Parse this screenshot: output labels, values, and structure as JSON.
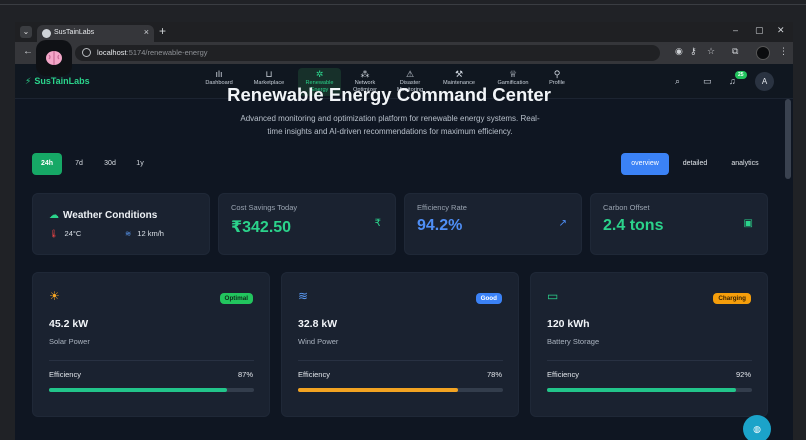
{
  "browser": {
    "tab_title": "SusTainLabs",
    "url_host": "localhost",
    "url_path": ":5174/renewable-energy",
    "new_tab": "+",
    "close": "×",
    "minimize": "–",
    "restore": "▢",
    "win_close": "✕"
  },
  "app": {
    "logo": "SusTainLabs",
    "nav": [
      {
        "label": "Dashboard",
        "icon": "bar-chart-icon"
      },
      {
        "label": "Marketplace",
        "icon": "cart-icon"
      },
      {
        "label": "Renewable Energy",
        "icon": "sparkle-icon",
        "active": true
      },
      {
        "label": "Network Optimizer",
        "icon": "network-icon"
      },
      {
        "label": "Disaster Monitoring",
        "icon": "warning-icon"
      },
      {
        "label": "Maintenance",
        "icon": "wrench-icon"
      },
      {
        "label": "Gamification",
        "icon": "trophy-icon"
      },
      {
        "label": "Profile",
        "icon": "user-icon"
      }
    ],
    "notification_count": "25",
    "avatar_initial": "A"
  },
  "hero": {
    "title": "Renewable Energy Command Center",
    "subtitle": "Advanced monitoring and optimization platform for renewable energy systems. Real-time insights and AI-driven recommendations for maximum efficiency."
  },
  "time_ranges": [
    "24h",
    "7d",
    "30d",
    "1y"
  ],
  "active_range": "24h",
  "views": [
    "overview",
    "detailed",
    "analytics"
  ],
  "active_view": "overview",
  "weather": {
    "title": "Weather Conditions",
    "temperature": "24°C",
    "wind": "12 km/h"
  },
  "kpis": [
    {
      "label": "Cost Savings Today",
      "value": "₹342.50",
      "color": "#2bd38b",
      "icon": "rupee-icon"
    },
    {
      "label": "Efficiency Rate",
      "value": "94.2%",
      "color": "#4f8ff7",
      "icon": "trend-up-icon"
    },
    {
      "label": "Carbon Offset",
      "value": "2.4 tons",
      "color": "#2bd38b",
      "icon": "calendar-icon"
    }
  ],
  "sources": [
    {
      "value": "45.2 kW",
      "name": "Solar Power",
      "badge": "Optimal",
      "badge_bg": "#22c55e",
      "badge_fg": "#0f2a1a",
      "icon": "sun-icon",
      "icon_color": "#f5a524",
      "efficiency_label": "Efficiency",
      "efficiency_pct": "87%",
      "efficiency": 0.87,
      "bar_color": "#22c58a"
    },
    {
      "value": "32.8 kW",
      "name": "Wind Power",
      "badge": "Good",
      "badge_bg": "#3b82f6",
      "badge_fg": "#ffffff",
      "icon": "wind-icon",
      "icon_color": "#5b9cf7",
      "efficiency_label": "Efficiency",
      "efficiency_pct": "78%",
      "efficiency": 0.78,
      "bar_color": "#f2a322"
    },
    {
      "value": "120 kWh",
      "name": "Battery Storage",
      "badge": "Charging",
      "badge_bg": "#f59e0b",
      "badge_fg": "#3a2202",
      "icon": "battery-icon",
      "icon_color": "#2bd38b",
      "efficiency_label": "Efficiency",
      "efficiency_pct": "92%",
      "efficiency": 0.92,
      "bar_color": "#22c58a"
    }
  ]
}
